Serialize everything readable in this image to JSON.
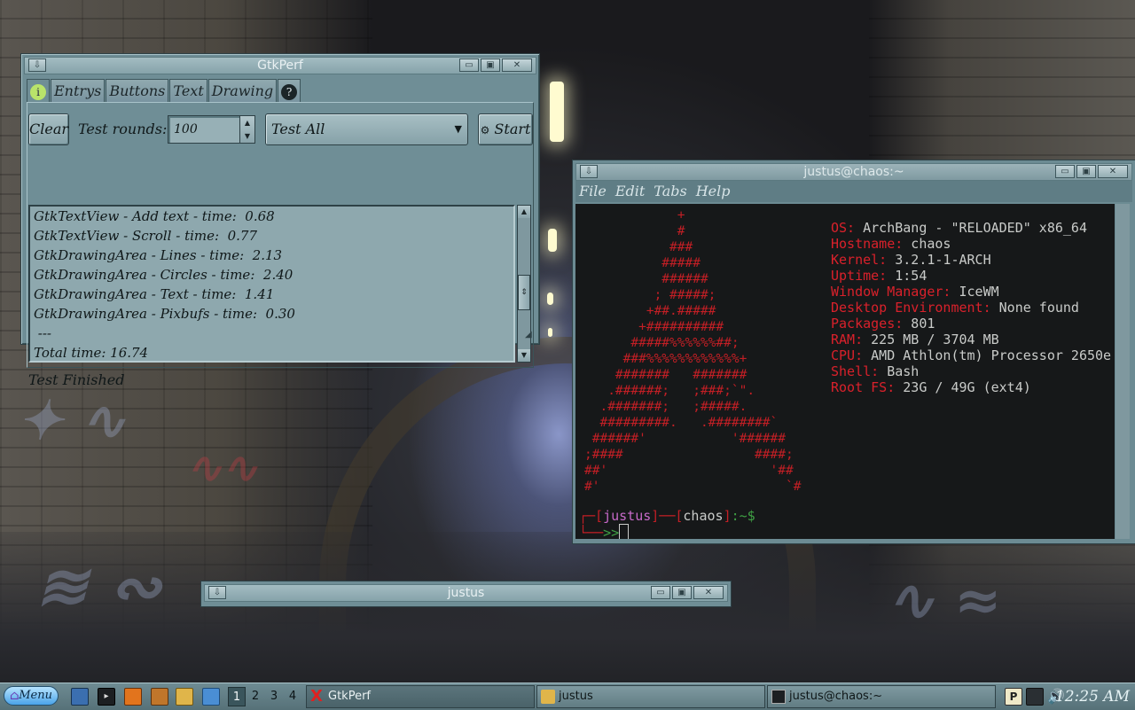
{
  "gtkperf": {
    "title": "GtkPerf",
    "tabs": [
      "Entrys",
      "Buttons",
      "Text",
      "Drawing"
    ],
    "clear_label": "Clear",
    "test_rounds_label": "Test rounds:",
    "test_rounds_value": "100",
    "test_select": "Test All",
    "start_label": "Start",
    "results": [
      "GtkTextView - Add text - time:  0.68",
      "GtkTextView - Scroll - time:  0.77",
      "GtkDrawingArea - Lines - time:  2.13",
      "GtkDrawingArea - Circles - time:  2.40",
      "GtkDrawingArea - Text - time:  1.41",
      "GtkDrawingArea - Pixbufs - time:  0.30",
      " ---",
      "Total time: 16.74"
    ],
    "status": "Test Finished"
  },
  "terminal": {
    "title": "justus@chaos:~",
    "menu": [
      "File",
      "Edit",
      "Tabs",
      "Help"
    ],
    "logo": [
      "            +",
      "            #",
      "           ###",
      "          #####",
      "          ######",
      "         ; #####;",
      "        +##.#####",
      "       +##########",
      "      #####%%%%%%##;",
      "     ###%%%%%%%%%%%%+",
      "    #######   #######",
      "   .######;   ;###;`\".",
      "  .#######;   ;#####.",
      "  #########.   .########`",
      " ######'           '######",
      ";####                 ####;",
      "##'                     '##",
      "#'                        `#"
    ],
    "info": [
      {
        "k": "OS:",
        "v": " ArchBang - \"RELOADED\" x86_64"
      },
      {
        "k": "Hostname:",
        "v": " chaos"
      },
      {
        "k": "Kernel:",
        "v": " 3.2.1-1-ARCH"
      },
      {
        "k": "Uptime:",
        "v": " 1:54"
      },
      {
        "k": "Window Manager:",
        "v": " IceWM"
      },
      {
        "k": "Desktop Environment:",
        "v": " None found"
      },
      {
        "k": "Packages:",
        "v": " 801"
      },
      {
        "k": "RAM:",
        "v": " 225 MB / 3704 MB"
      },
      {
        "k": "CPU:",
        "v": " AMD Athlon(tm) Processor 2650e"
      },
      {
        "k": "Shell:",
        "v": " Bash"
      },
      {
        "k": "Root FS:",
        "v": " 23G / 49G (ext4)"
      }
    ],
    "prompt_user": "justus",
    "prompt_host": "chaos",
    "prompt_path": ":~$",
    "prompt_arrow": ">>"
  },
  "min_window": {
    "title": "justus"
  },
  "taskbar": {
    "menu_label": "Menu",
    "workspaces": [
      "1",
      "2",
      "3",
      "4"
    ],
    "tasks": [
      "GtkPerf",
      "justus",
      "justus@chaos:~"
    ],
    "clock": "12:25 AM"
  }
}
